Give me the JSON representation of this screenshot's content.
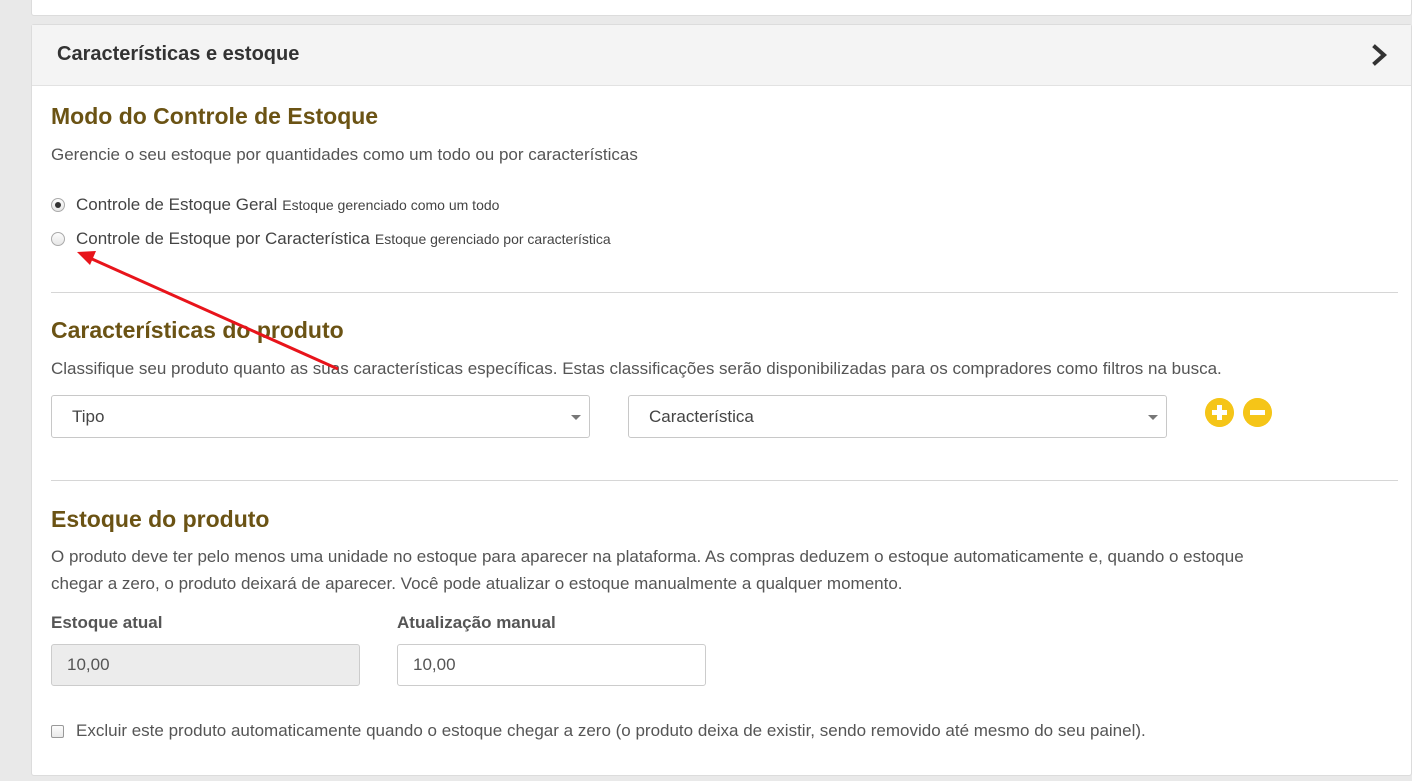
{
  "panel": {
    "title": "Características e estoque",
    "toggle_icon": "chevron-right-icon"
  },
  "stock_mode": {
    "title": "Modo do Controle de Estoque",
    "description": "Gerencie o seu estoque por quantidades como um todo ou por características",
    "options": [
      {
        "label": "Controle de Estoque Geral",
        "hint": "Estoque gerenciado como um todo",
        "checked": true
      },
      {
        "label": "Controle de Estoque por Característica",
        "hint": "Estoque gerenciado por característica",
        "checked": false
      }
    ]
  },
  "characteristics": {
    "title": "Características do produto",
    "description": "Classifique seu produto quanto as suas características específicas. Estas classificações serão disponibilizadas para os compradores como filtros na busca.",
    "type_select": "Tipo",
    "feature_select": "Característica",
    "add_icon": "plus-circle-icon",
    "remove_icon": "minus-circle-icon",
    "button_color": "#f5c518"
  },
  "stock": {
    "title": "Estoque do produto",
    "description_line1": "O produto deve ter pelo menos uma unidade no estoque para aparecer na plataforma. As compras deduzem o estoque automaticamente e, quando o estoque",
    "description_line2": "chegar a zero, o produto deixará de aparecer. Você pode atualizar o estoque manualmente a qualquer momento.",
    "current_label": "Estoque atual",
    "current_value": "10,00",
    "manual_label": "Atualização manual",
    "manual_value": "10,00",
    "auto_delete_label": "Excluir este produto automaticamente quando o estoque chegar a zero (o produto deixa de existir, sendo removido até mesmo do seu painel).",
    "auto_delete_checked": false
  },
  "annotation": {
    "arrow_icon": "red-arrow-annotation",
    "color": "#e8141b"
  }
}
